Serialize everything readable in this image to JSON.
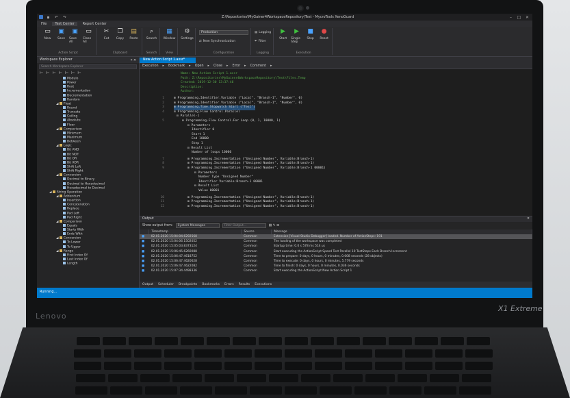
{
  "window": {
    "title": "Z:\\Repositories\\MyGainer4WorkspaceRepository\\Test - MycroTools XenoGuard"
  },
  "menu": [
    "File",
    "Test Center",
    "Report Center"
  ],
  "ribbon": {
    "groups": [
      {
        "label": "Action Script",
        "buttons": [
          "New",
          "Save",
          "Save All",
          "Close All"
        ]
      },
      {
        "label": "Clipboard",
        "buttons": [
          "Cut",
          "Copy",
          "Paste"
        ]
      },
      {
        "label": "Search",
        "buttons": [
          "Search"
        ]
      },
      {
        "label": "View",
        "buttons": [
          "Window"
        ]
      },
      {
        "label": "",
        "buttons": [
          "Settings"
        ]
      }
    ],
    "configuration": {
      "label": "Configuration",
      "select": "Production",
      "sync": "New Synchronization"
    },
    "logging": {
      "label": "Logging",
      "items": [
        "Logging",
        "Filter"
      ]
    },
    "execution": {
      "label": "Execution",
      "buttons": [
        "Start",
        "Single Step",
        "Stop",
        "Reset"
      ]
    }
  },
  "explorer": {
    "title": "Workspace Explorer",
    "search_placeholder": "Search Workspace Explorer",
    "nodes": [
      {
        "label": "Modulo",
        "indent": 3
      },
      {
        "label": "Power",
        "indent": 3
      },
      {
        "label": "Root",
        "indent": 3
      },
      {
        "label": "Incrementation",
        "indent": 3
      },
      {
        "label": "Decrementation",
        "indent": 3
      },
      {
        "label": "Random",
        "indent": 3
      },
      {
        "label": "Float",
        "indent": 2,
        "folder": true
      },
      {
        "label": "Round",
        "indent": 3
      },
      {
        "label": "Truncate",
        "indent": 3
      },
      {
        "label": "Ceiling",
        "indent": 3
      },
      {
        "label": "Absolute",
        "indent": 3
      },
      {
        "label": "Floor",
        "indent": 3
      },
      {
        "label": "Comparison",
        "indent": 2,
        "folder": true
      },
      {
        "label": "Minimum",
        "indent": 3
      },
      {
        "label": "Maximum",
        "indent": 3
      },
      {
        "label": "Between",
        "indent": 3
      },
      {
        "label": "Logic",
        "indent": 2,
        "folder": true
      },
      {
        "label": "Bit AND",
        "indent": 3
      },
      {
        "label": "Bit NOT",
        "indent": 3
      },
      {
        "label": "Bit OR",
        "indent": 3
      },
      {
        "label": "Bit XOR",
        "indent": 3
      },
      {
        "label": "Shift Left",
        "indent": 3
      },
      {
        "label": "Shift Right",
        "indent": 3
      },
      {
        "label": "Conversion",
        "indent": 2,
        "folder": true
      },
      {
        "label": "Decimal to Binary",
        "indent": 3
      },
      {
        "label": "Decimal to Hexadecimal",
        "indent": 3
      },
      {
        "label": "Hexadecimal to Decimal",
        "indent": 3
      },
      {
        "label": "String Operation",
        "indent": 1,
        "folder": true
      },
      {
        "label": "Addendum",
        "indent": 2,
        "folder": true
      },
      {
        "label": "Insertion",
        "indent": 3
      },
      {
        "label": "Concatenation",
        "indent": 3
      },
      {
        "label": "Replace",
        "indent": 3
      },
      {
        "label": "Pad Left",
        "indent": 3
      },
      {
        "label": "Pad Right",
        "indent": 3
      },
      {
        "label": "Comparison",
        "indent": 2,
        "folder": true
      },
      {
        "label": "Equals",
        "indent": 3
      },
      {
        "label": "Starts With",
        "indent": 3
      },
      {
        "label": "Ends With",
        "indent": 3
      },
      {
        "label": "Conversion",
        "indent": 2,
        "folder": true
      },
      {
        "label": "To Lower",
        "indent": 3
      },
      {
        "label": "To Upper",
        "indent": 3
      },
      {
        "label": "Range",
        "indent": 2,
        "folder": true
      },
      {
        "label": "First Index Of",
        "indent": 3
      },
      {
        "label": "Last Index Of",
        "indent": 3
      },
      {
        "label": "Length",
        "indent": 3
      }
    ]
  },
  "editor": {
    "tab": "New Action Script 1.axsr*",
    "toolbar": [
      "Execution",
      "Bookmark",
      "Open",
      "Close",
      "Error",
      "Comment"
    ],
    "header": [
      {
        "k": "Name:",
        "v": "New Action Script 1.axsr"
      },
      {
        "k": "Path:",
        "v": "Z:\\Repositories\\MyGainer4WorkspaceRepository\\Test\\Files.Temp"
      },
      {
        "k": "Created:",
        "v": "2019-12-30 13:37:46"
      },
      {
        "k": "Description:",
        "v": ""
      },
      {
        "k": "Author:",
        "v": ""
      }
    ],
    "lines": [
      {
        "n": "1",
        "text": "Programming.Identifier.Variable (\"Local\", \"Branch-1\", \"Number\", 0)"
      },
      {
        "n": "2",
        "text": "Programming.Identifier.Variable (\"Local\", \"Branch-1\", \"Number\", 0)"
      },
      {
        "n": "3",
        "text": "Programming.Time.Stopwatch Start (\"Test\")",
        "highlight": true
      },
      {
        "n": "4",
        "text": "Programming.Flow Control.Parallel"
      },
      {
        "n": "",
        "text": "Parallel-1"
      },
      {
        "n": "5",
        "text": "Programming.Flow Control.For Loop (0, 1, 10000, 1)"
      },
      {
        "n": "",
        "text": "Parameters"
      }
    ],
    "params": [
      {
        "k": "Identifier",
        "v": "0"
      },
      {
        "k": "Start",
        "v": "1"
      },
      {
        "k": "End",
        "v": "10000"
      },
      {
        "k": "Step",
        "v": "1"
      }
    ],
    "result_list_label": "Result List",
    "loops": {
      "k": "Number of loops",
      "v": "10000"
    },
    "inc_lines": [
      {
        "n": "7",
        "text": "Programming.Incrementation (\"Unsigned Number\", Variable:Branch-1)"
      },
      {
        "n": "8",
        "text": "Programming.Incrementation (\"Unsigned Number\", Variable:Branch-1)"
      },
      {
        "n": "9",
        "text": "Programming.Incrementation (\"Unsigned Number\", Variable:Branch-1 00001)"
      }
    ],
    "parameters_label": "Parameters",
    "inc_params": [
      {
        "k": "Number Type",
        "v": "\"Unsigned Number\""
      },
      {
        "k": "Identifier",
        "v": "Variable:Branch-1 00001"
      }
    ],
    "value": {
      "k": "Value",
      "v": "00001"
    },
    "tail_lines": [
      {
        "n": "10",
        "text": "Programming.Incrementation (\"Unsigned Number\", Variable:Branch-1)"
      },
      {
        "n": "11",
        "text": "Programming.Incrementation (\"Unsigned Number\", Variable:Branch-1)"
      },
      {
        "n": "12",
        "text": "Programming.Incrementation (\"Unsigned Number\", Variable:Branch-1)"
      }
    ]
  },
  "output": {
    "title": "Output",
    "show_from_label": "Show output from:",
    "source_select": "System Messages",
    "filter_placeholder": "Filter Output...",
    "columns": [
      "Timestamp",
      "Source",
      "Message"
    ],
    "rows": [
      {
        "ts": "02.01.2020 15:04:04.6292568",
        "src": "Common",
        "msg": "Extension [Visual Studio Debugger] loaded. Number of ActionSteps: 191"
      },
      {
        "ts": "02.01.2020 15:04:06.1502052",
        "src": "Common",
        "msg": "The loading of the workspace was completed"
      },
      {
        "ts": "02.01.2020 15:05:03.8373124",
        "src": "Common",
        "msg": "Startup time: 0.0 s 578 ms 514 us"
      },
      {
        "ts": "02.01.2020 15:06:45.6260088",
        "src": "Common",
        "msg": "Start executing the ActionScript Speed Test Parallel 10 TestSteps Each Branch Increment"
      },
      {
        "ts": "02.01.2020 15:06:47.4618752",
        "src": "Common",
        "msg": "Time to prepare: 0 days, 0 hours, 0 minutes, 0.008 seconds (28 objects)"
      },
      {
        "ts": "02.01.2020 15:06:47.4620628",
        "src": "Common",
        "msg": "Time to execute: 0 days, 0 hours, 0 minutes, 5.779 seconds"
      },
      {
        "ts": "02.01.2020 15:06:47.4622082",
        "src": "Common",
        "msg": "Time to finish: 0 days, 0 hours, 0 minutes, 0.036 seconds"
      },
      {
        "ts": "02.01.2020 15:07:34.4498336",
        "src": "Common",
        "msg": "Start executing the ActionScript New Action Script 1"
      }
    ],
    "tabs": [
      "Output",
      "Scheduler",
      "Breakpoints",
      "Bookmarks",
      "Errors",
      "Results",
      "Executions"
    ]
  },
  "status": "Running...",
  "laptop": {
    "brand": "Lenovo",
    "model": "X1 Extreme"
  },
  "colors": {
    "accent": "#007acc",
    "comment": "#57a64a",
    "string": "#d69d85",
    "keyword": "#569cd6",
    "number": "#e05555"
  }
}
